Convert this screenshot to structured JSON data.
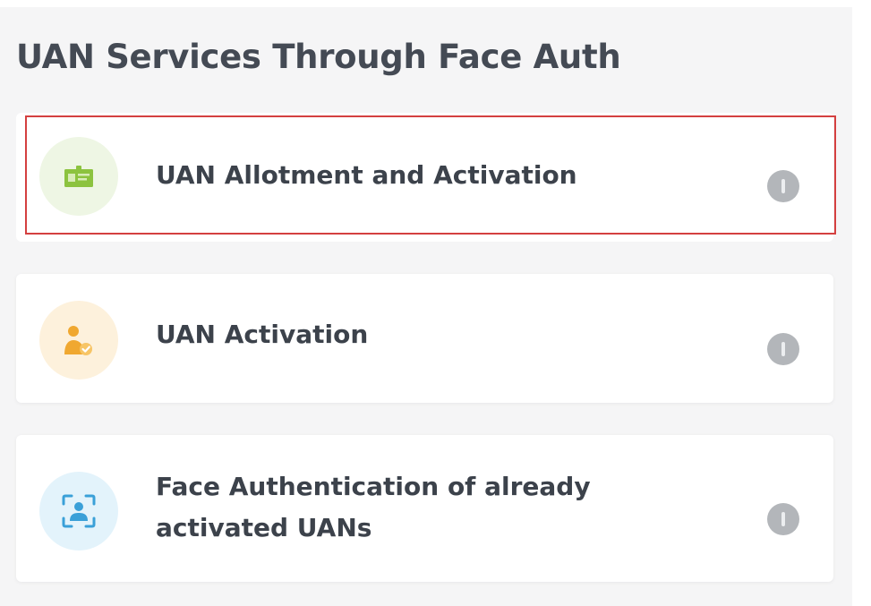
{
  "section": {
    "title": "UAN Services Through Face Auth"
  },
  "services": [
    {
      "label": "UAN Allotment and Activation",
      "icon": "id-card-icon",
      "accent": "#8cc33f"
    },
    {
      "label": "UAN Activation",
      "icon": "user-check-icon",
      "accent": "#f0a830"
    },
    {
      "label": "Face Authentication of already\nactivated UANs",
      "icon": "face-scan-icon",
      "accent": "#3aa0d8"
    }
  ],
  "colors": {
    "highlight_border": "#d44040",
    "title_text": "#444a54",
    "info_icon": "#b3b6ba"
  }
}
